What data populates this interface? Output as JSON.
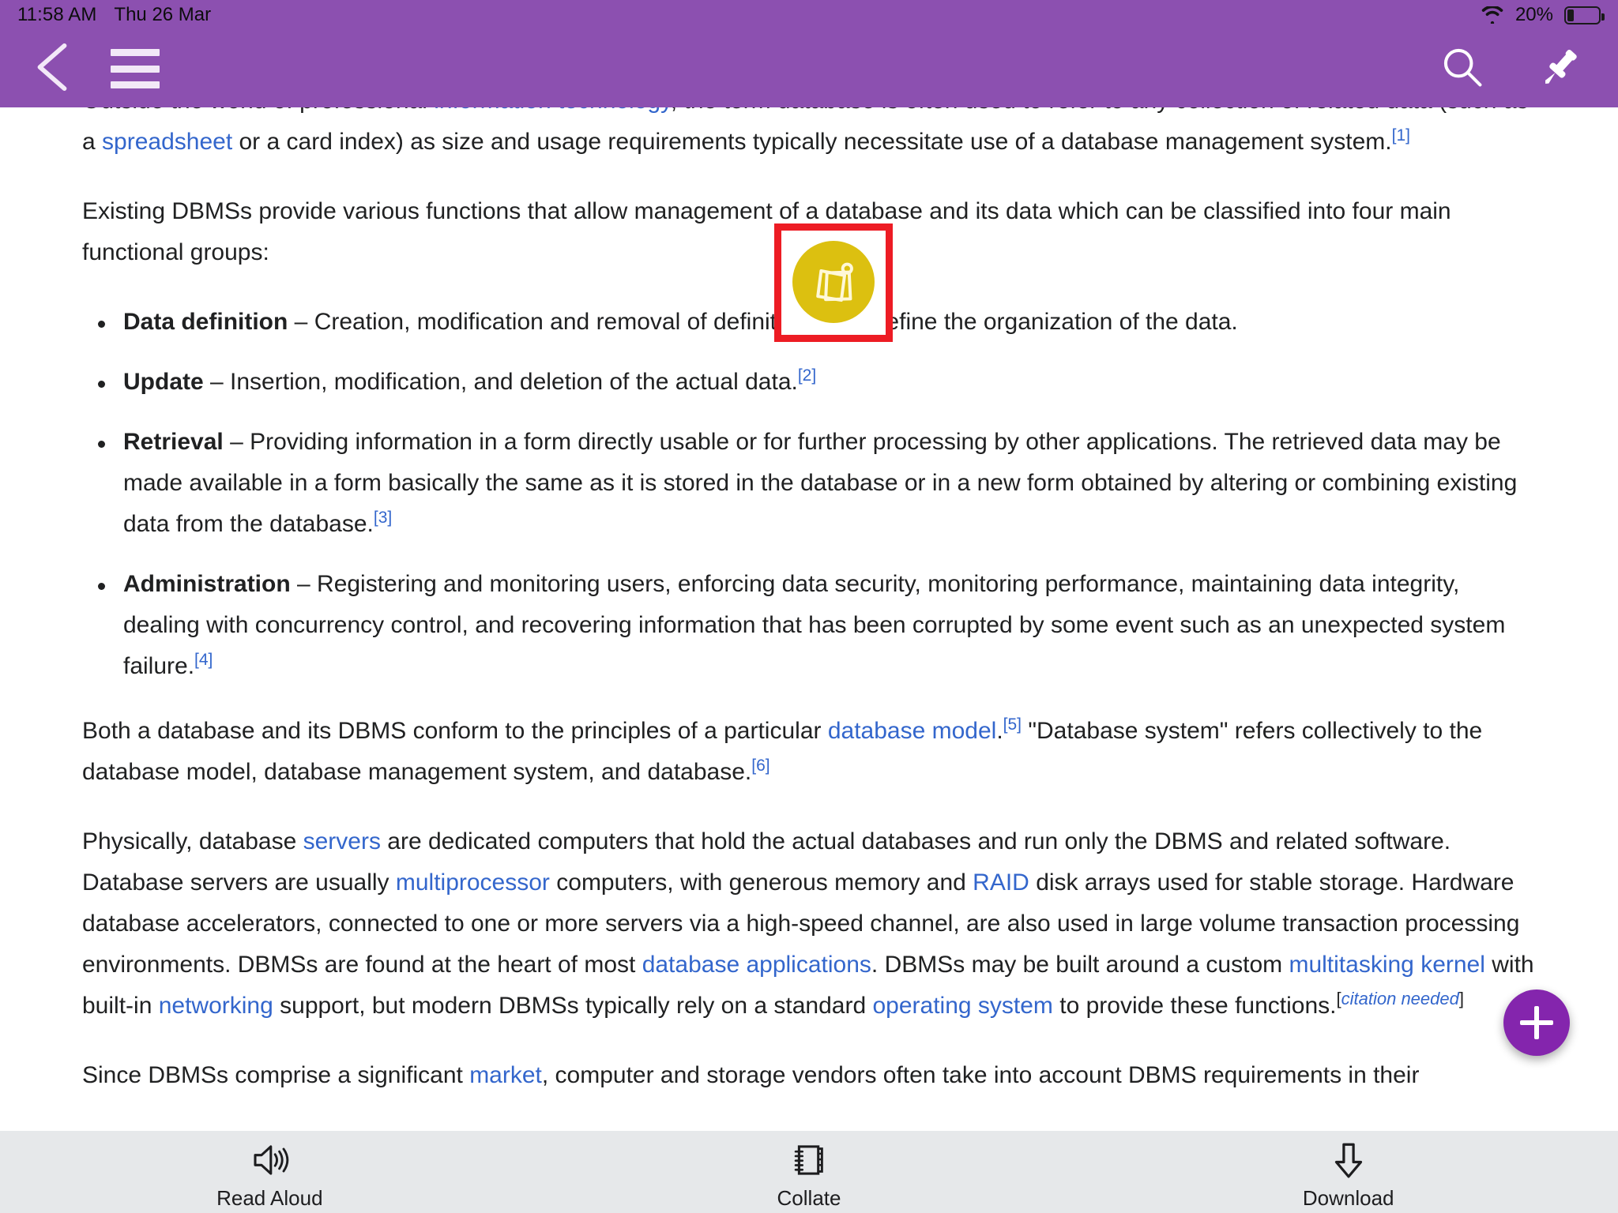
{
  "statusbar": {
    "time": "11:58 AM",
    "date": "Thu 26 Mar",
    "wifi_icon": "wifi-icon",
    "battery_percent": "20%",
    "battery_level": 20
  },
  "navbar": {
    "back_icon": "chevron-left-icon",
    "menu_icon": "hamburger-menu-icon",
    "search_icon": "search-icon",
    "pin_icon": "pushpin-icon",
    "background_color": "#8c50b0"
  },
  "article": {
    "paragraphs": [
      {
        "id": "p-cutoff",
        "runs": [
          {
            "t": "Outside the world of professional ",
            "k": "text"
          },
          {
            "t": "information technology",
            "k": "link"
          },
          {
            "t": ", the term database is often used to refer to any collection of related data (such as a ",
            "k": "text"
          },
          {
            "t": "spreadsheet",
            "k": "link"
          },
          {
            "t": " or a card index) as size and usage requirements typically necessitate use of a database management system.",
            "k": "text"
          },
          {
            "t": "[1]",
            "k": "ref"
          }
        ]
      },
      {
        "id": "p-existing",
        "runs": [
          {
            "t": "Existing DBMSs provide various functions that allow management of a database and its data which can be classified into four main functional groups:",
            "k": "text"
          }
        ]
      }
    ],
    "bullets": [
      {
        "term": "Data definition",
        "runs": [
          {
            "t": " – Creation, modification and removal of definitions that define the organization of the data.",
            "k": "text"
          }
        ]
      },
      {
        "term": "Update",
        "runs": [
          {
            "t": " – Insertion, modification, and deletion of the actual data.",
            "k": "text"
          },
          {
            "t": "[2]",
            "k": "ref"
          }
        ]
      },
      {
        "term": "Retrieval",
        "runs": [
          {
            "t": " – Providing information in a form directly usable or for further processing by other applications. The retrieved data may be made available in a form basically the same as it is stored in the database or in a new form obtained by altering or combining existing data from the database.",
            "k": "text"
          },
          {
            "t": "[3]",
            "k": "ref"
          }
        ]
      },
      {
        "term": "Administration",
        "runs": [
          {
            "t": " – Registering and monitoring users, enforcing data security, monitoring performance, maintaining data integrity, dealing with concurrency control, and recovering information that has been corrupted by some event such as an unexpected system failure.",
            "k": "text"
          },
          {
            "t": "[4]",
            "k": "ref"
          }
        ]
      }
    ],
    "paragraphs_after": [
      {
        "id": "p-both",
        "runs": [
          {
            "t": "Both a database and its DBMS conform to the principles of a particular ",
            "k": "text"
          },
          {
            "t": "database model",
            "k": "link"
          },
          {
            "t": ".",
            "k": "text"
          },
          {
            "t": "[5]",
            "k": "ref"
          },
          {
            "t": " \"Database system\" refers collectively to the database model, database management system, and database.",
            "k": "text"
          },
          {
            "t": "[6]",
            "k": "ref"
          }
        ]
      },
      {
        "id": "p-physically",
        "runs": [
          {
            "t": "Physically, database ",
            "k": "text"
          },
          {
            "t": "servers",
            "k": "link"
          },
          {
            "t": " are dedicated computers that hold the actual databases and run only the DBMS and related software. Database servers are usually ",
            "k": "text"
          },
          {
            "t": "multiprocessor",
            "k": "link"
          },
          {
            "t": " computers, with generous memory and ",
            "k": "text"
          },
          {
            "t": "RAID",
            "k": "link"
          },
          {
            "t": " disk arrays used for stable storage. Hardware database accelerators, connected to one or more servers via a high-speed channel, are also used in large volume transaction processing environments. DBMSs are found at the heart of most ",
            "k": "text"
          },
          {
            "t": "database applications",
            "k": "link"
          },
          {
            "t": ". DBMSs may be built around a custom ",
            "k": "text"
          },
          {
            "t": "multitasking kernel",
            "k": "link"
          },
          {
            "t": " with built-in ",
            "k": "text"
          },
          {
            "t": "networking",
            "k": "link"
          },
          {
            "t": " support, but modern DBMSs typically rely on a standard ",
            "k": "text"
          },
          {
            "t": "operating system",
            "k": "link"
          },
          {
            "t": " to provide these functions.",
            "k": "text"
          },
          {
            "t": "[",
            "k": "cn-bracket"
          },
          {
            "t": "citation needed",
            "k": "citation-needed"
          },
          {
            "t": "]",
            "k": "cn-bracket"
          }
        ]
      },
      {
        "id": "p-since",
        "runs": [
          {
            "t": "Since DBMSs comprise a significant ",
            "k": "text"
          },
          {
            "t": "market",
            "k": "link"
          },
          {
            "t": ", computer and storage vendors often take into account DBMS requirements in their",
            "k": "text"
          }
        ]
      }
    ],
    "link_color": "#3366cc",
    "text_color": "#202122"
  },
  "overlay": {
    "highlight_color": "#ed1c24",
    "note_fab": {
      "icon": "sticky-notes-icon",
      "color": "#dcc010"
    }
  },
  "fab": {
    "icon": "plus-icon",
    "color": "#8425ad"
  },
  "bottombar": {
    "background_color": "#e6e8ea",
    "items": [
      {
        "icon": "speaker-volume-icon",
        "label": "Read Aloud"
      },
      {
        "icon": "notebook-pages-icon",
        "label": "Collate"
      },
      {
        "icon": "download-arrow-icon",
        "label": "Download"
      }
    ]
  }
}
